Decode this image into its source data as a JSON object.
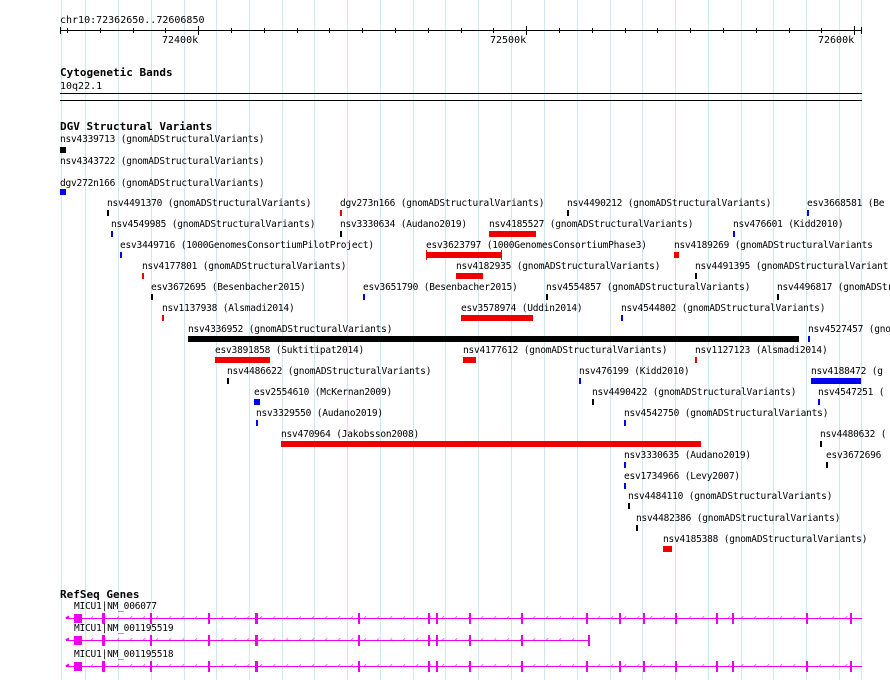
{
  "ruler": {
    "location": "chr10:72362650..72606850",
    "ticks": [
      "72400k",
      "72500k",
      "72600k"
    ]
  },
  "cytobands": {
    "title": "Cytogenetic Bands",
    "band": "10q22.1"
  },
  "dgv": {
    "title": "DGV Structural Variants",
    "colors": {
      "black": "#000000",
      "blue": "#0000ee",
      "red": "#ee0000"
    },
    "features": [
      {
        "label": "nsv4339713 (gnomADStructuralVariants)",
        "color": "black"
      },
      {
        "label": "nsv4343722 (gnomADStructuralVariants)",
        "color": "black"
      },
      {
        "label": "dgv272n166 (gnomADStructuralVariants)",
        "color": "blue"
      },
      {
        "label": "nsv4491370 (gnomADStructuralVariants)",
        "color": "black"
      },
      {
        "label": "dgv273n166 (gnomADStructuralVariants)",
        "color": "red"
      },
      {
        "label": "nsv4490212 (gnomADStructuralVariants)",
        "color": "black"
      },
      {
        "label": "esv3668581 (Be",
        "color": "blue"
      },
      {
        "label": "nsv4549985 (gnomADStructuralVariants)",
        "color": "blue"
      },
      {
        "label": "nsv3330634 (Audano2019)",
        "color": "black"
      },
      {
        "label": "nsv4185527 (gnomADStructuralVariants)",
        "color": "red"
      },
      {
        "label": "nsv476601 (Kidd2010)",
        "color": "blue"
      },
      {
        "label": "esv3449716 (1000GenomesConsortiumPilotProject)",
        "color": "blue"
      },
      {
        "label": "esv3623797 (1000GenomesConsortiumPhase3)",
        "color": "red"
      },
      {
        "label": "nsv4189269 (gnomADStructuralVariants",
        "color": "red"
      },
      {
        "label": "nsv4177801 (gnomADStructuralVariants)",
        "color": "red"
      },
      {
        "label": "nsv4182935 (gnomADStructuralVariants)",
        "color": "red"
      },
      {
        "label": "nsv4491395 (gnomADStructuralVariant",
        "color": "black"
      },
      {
        "label": "esv3672695 (Besenbacher2015)",
        "color": "black"
      },
      {
        "label": "esv3651790 (Besenbacher2015)",
        "color": "blue"
      },
      {
        "label": "nsv4554857 (gnomADStructuralVariants)",
        "color": "black"
      },
      {
        "label": "nsv4496817 (gnomADStruct",
        "color": "black"
      },
      {
        "label": "nsv1137938 (Alsmadi2014)",
        "color": "red"
      },
      {
        "label": "esv3578974 (Uddin2014)",
        "color": "red"
      },
      {
        "label": "nsv4544802 (gnomADStructuralVariants)",
        "color": "blue"
      },
      {
        "label": "nsv4336952 (gnomADStructuralVariants)",
        "color": "black"
      },
      {
        "label": "nsv4527457 (gnom",
        "color": "blue"
      },
      {
        "label": "esv3891858 (Suktitipat2014)",
        "color": "red"
      },
      {
        "label": "nsv4177612 (gnomADStructuralVariants)",
        "color": "red"
      },
      {
        "label": "nsv1127123 (Alsmadi2014)",
        "color": "red"
      },
      {
        "label": "nsv4486622 (gnomADStructuralVariants)",
        "color": "black"
      },
      {
        "label": "nsv476199 (Kidd2010)",
        "color": "blue"
      },
      {
        "label": "nsv4188472 (g",
        "color": "blue"
      },
      {
        "label": "esv2554610 (McKernan2009)",
        "color": "blue"
      },
      {
        "label": "nsv4490422 (gnomADStructuralVariants)",
        "color": "black"
      },
      {
        "label": "nsv4547251 (",
        "color": "blue"
      },
      {
        "label": "nsv3329550 (Audano2019)",
        "color": "blue"
      },
      {
        "label": "nsv4542750 (gnomADStructuralVariants)",
        "color": "blue"
      },
      {
        "label": "nsv470964 (Jakobsson2008)",
        "color": "red"
      },
      {
        "label": "nsv4480632 (",
        "color": "black"
      },
      {
        "label": "nsv3330635 (Audano2019)",
        "color": "blue"
      },
      {
        "label": "esv3672696",
        "color": "black"
      },
      {
        "label": "esv1734966 (Levy2007)",
        "color": "blue"
      },
      {
        "label": "nsv4484110 (gnomADStructuralVariants)",
        "color": "black"
      },
      {
        "label": "nsv4482386 (gnomADStructuralVariants)",
        "color": "black"
      },
      {
        "label": "nsv4185388 (gnomADStructuralVariants)",
        "color": "red"
      }
    ]
  },
  "refseq": {
    "title": "RefSeq Genes",
    "color": "#ee00ee",
    "transcripts": [
      {
        "label": "MICU1|NM_006077"
      },
      {
        "label": "MICU1|NM_001195519"
      },
      {
        "label": "MICU1|NM_001195518"
      }
    ]
  }
}
